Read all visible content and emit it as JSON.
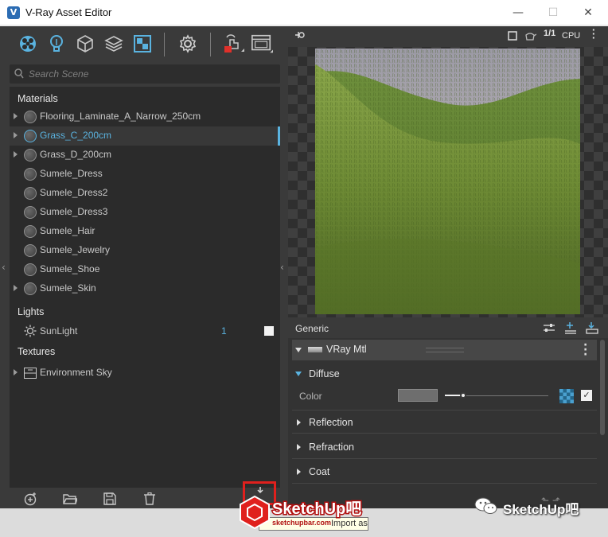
{
  "window": {
    "title": "V-Ray Asset Editor",
    "minimize": "—",
    "maximize": "☐",
    "close": "✕"
  },
  "toolbar": {
    "icons": [
      "materials-icon",
      "lights-icon",
      "geometry-icon",
      "layers-icon",
      "textures-icon",
      "settings-icon",
      "render-interactive-icon",
      "frame-buffer-icon"
    ]
  },
  "search": {
    "placeholder": "Search Scene"
  },
  "outliner": {
    "materials_header": "Materials",
    "materials": [
      {
        "label": "Flooring_Laminate_A_Narrow_250cm",
        "expandable": true
      },
      {
        "label": "Grass_C_200cm",
        "expandable": true,
        "selected": true
      },
      {
        "label": "Grass_D_200cm",
        "expandable": true
      },
      {
        "label": "Sumele_Dress",
        "expandable": false
      },
      {
        "label": "Sumele_Dress2",
        "expandable": false
      },
      {
        "label": "Sumele_Dress3",
        "expandable": false
      },
      {
        "label": "Sumele_Hair",
        "expandable": false
      },
      {
        "label": "Sumele_Jewelry",
        "expandable": false
      },
      {
        "label": "Sumele_Shoe",
        "expandable": false
      },
      {
        "label": "Sumele_Skin",
        "expandable": true
      }
    ],
    "lights_header": "Lights",
    "lights": [
      {
        "label": "SunLight",
        "count": "1",
        "enabled": true
      }
    ],
    "textures_header": "Textures",
    "textures": [
      {
        "label": "Environment Sky",
        "expandable": true
      }
    ]
  },
  "preview_toolbar": {
    "pin_icon": "pin-icon",
    "ratio": "1/1",
    "engine": "CPU"
  },
  "properties": {
    "panel_label": "Generic",
    "material_type": "VRay Mtl",
    "sections": [
      {
        "label": "Diffuse",
        "open": true
      },
      {
        "label": "Reflection",
        "open": false
      },
      {
        "label": "Refraction",
        "open": false
      },
      {
        "label": "Coat",
        "open": false
      }
    ],
    "diffuse_color_label": "Color",
    "diffuse_color": "#6e6e6e",
    "color_amount": 0.18,
    "texture_enabled": true
  },
  "overlay": {
    "tooltip_text": "Import asset",
    "watermark_logo": "SketchUp吧",
    "watermark_url": "sketchupbar.com",
    "watermark_right": "SketchUp吧"
  },
  "colors": {
    "accent": "#5ab3e0",
    "panel_bg": "#3a3a3a",
    "list_bg": "#2b2b2b",
    "highlight_box": "#e0201d"
  }
}
